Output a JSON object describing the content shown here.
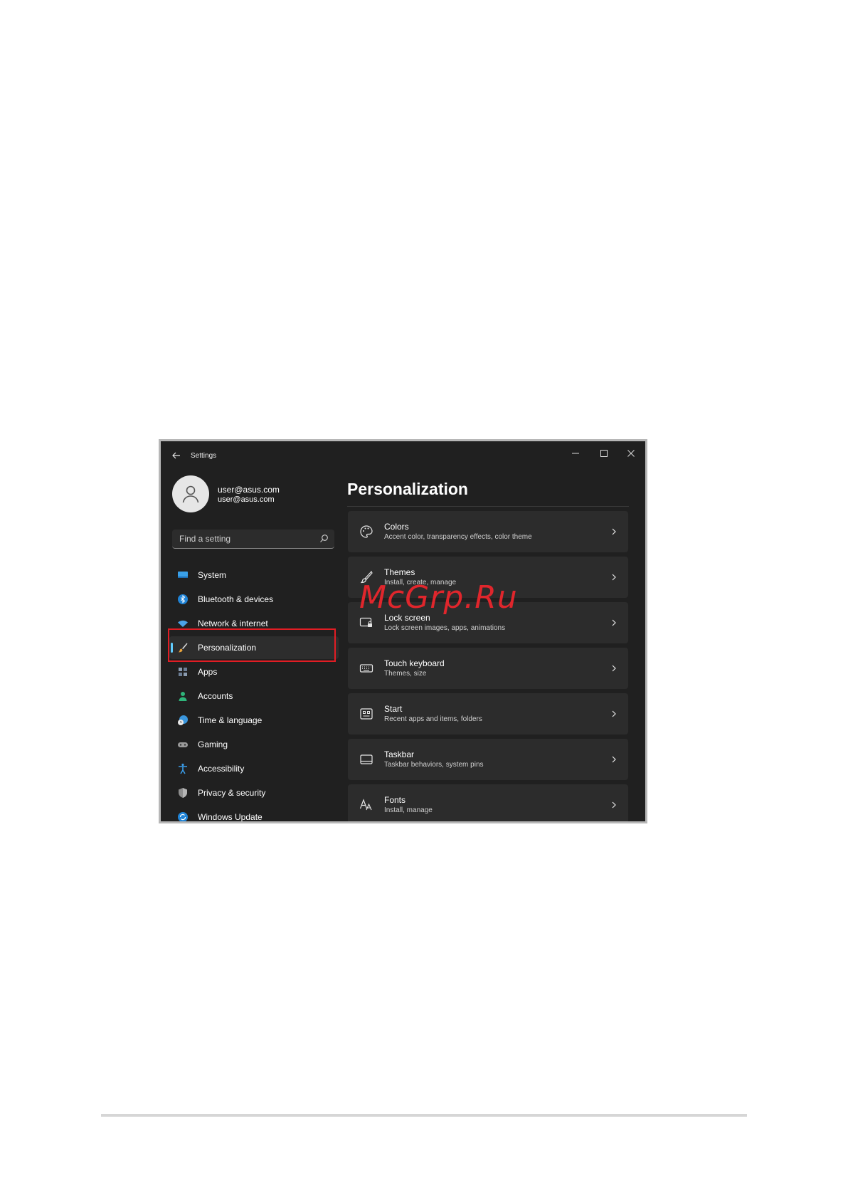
{
  "window": {
    "title": "Settings"
  },
  "account": {
    "name": "user@asus.com",
    "email": "user@asus.com"
  },
  "search": {
    "placeholder": "Find a setting"
  },
  "nav": {
    "items": [
      {
        "label": "System",
        "icon": "monitor-icon"
      },
      {
        "label": "Bluetooth & devices",
        "icon": "bluetooth-icon"
      },
      {
        "label": "Network & internet",
        "icon": "wifi-icon"
      },
      {
        "label": "Personalization",
        "icon": "paintbrush-icon",
        "active": true
      },
      {
        "label": "Apps",
        "icon": "apps-icon"
      },
      {
        "label": "Accounts",
        "icon": "person-icon"
      },
      {
        "label": "Time & language",
        "icon": "globe-clock-icon"
      },
      {
        "label": "Gaming",
        "icon": "gamepad-icon"
      },
      {
        "label": "Accessibility",
        "icon": "accessibility-icon"
      },
      {
        "label": "Privacy & security",
        "icon": "shield-icon"
      },
      {
        "label": "Windows Update",
        "icon": "update-icon"
      }
    ]
  },
  "main": {
    "title": "Personalization",
    "cards": [
      {
        "title": "Colors",
        "subtitle": "Accent color, transparency effects, color theme",
        "icon": "palette-icon"
      },
      {
        "title": "Themes",
        "subtitle": "Install, create, manage",
        "icon": "brush-icon"
      },
      {
        "title": "Lock screen",
        "subtitle": "Lock screen images, apps, animations",
        "icon": "lock-screen-icon"
      },
      {
        "title": "Touch keyboard",
        "subtitle": "Themes, size",
        "icon": "keyboard-icon"
      },
      {
        "title": "Start",
        "subtitle": "Recent apps and items, folders",
        "icon": "start-icon"
      },
      {
        "title": "Taskbar",
        "subtitle": "Taskbar behaviors, system pins",
        "icon": "taskbar-icon"
      },
      {
        "title": "Fonts",
        "subtitle": "Install, manage",
        "icon": "fonts-icon"
      }
    ]
  },
  "watermark": "McGrp.Ru",
  "colors": {
    "background": "#202020",
    "card": "#2c2c2c",
    "accent": "#60cdff",
    "highlight_box": "#e11d24"
  }
}
